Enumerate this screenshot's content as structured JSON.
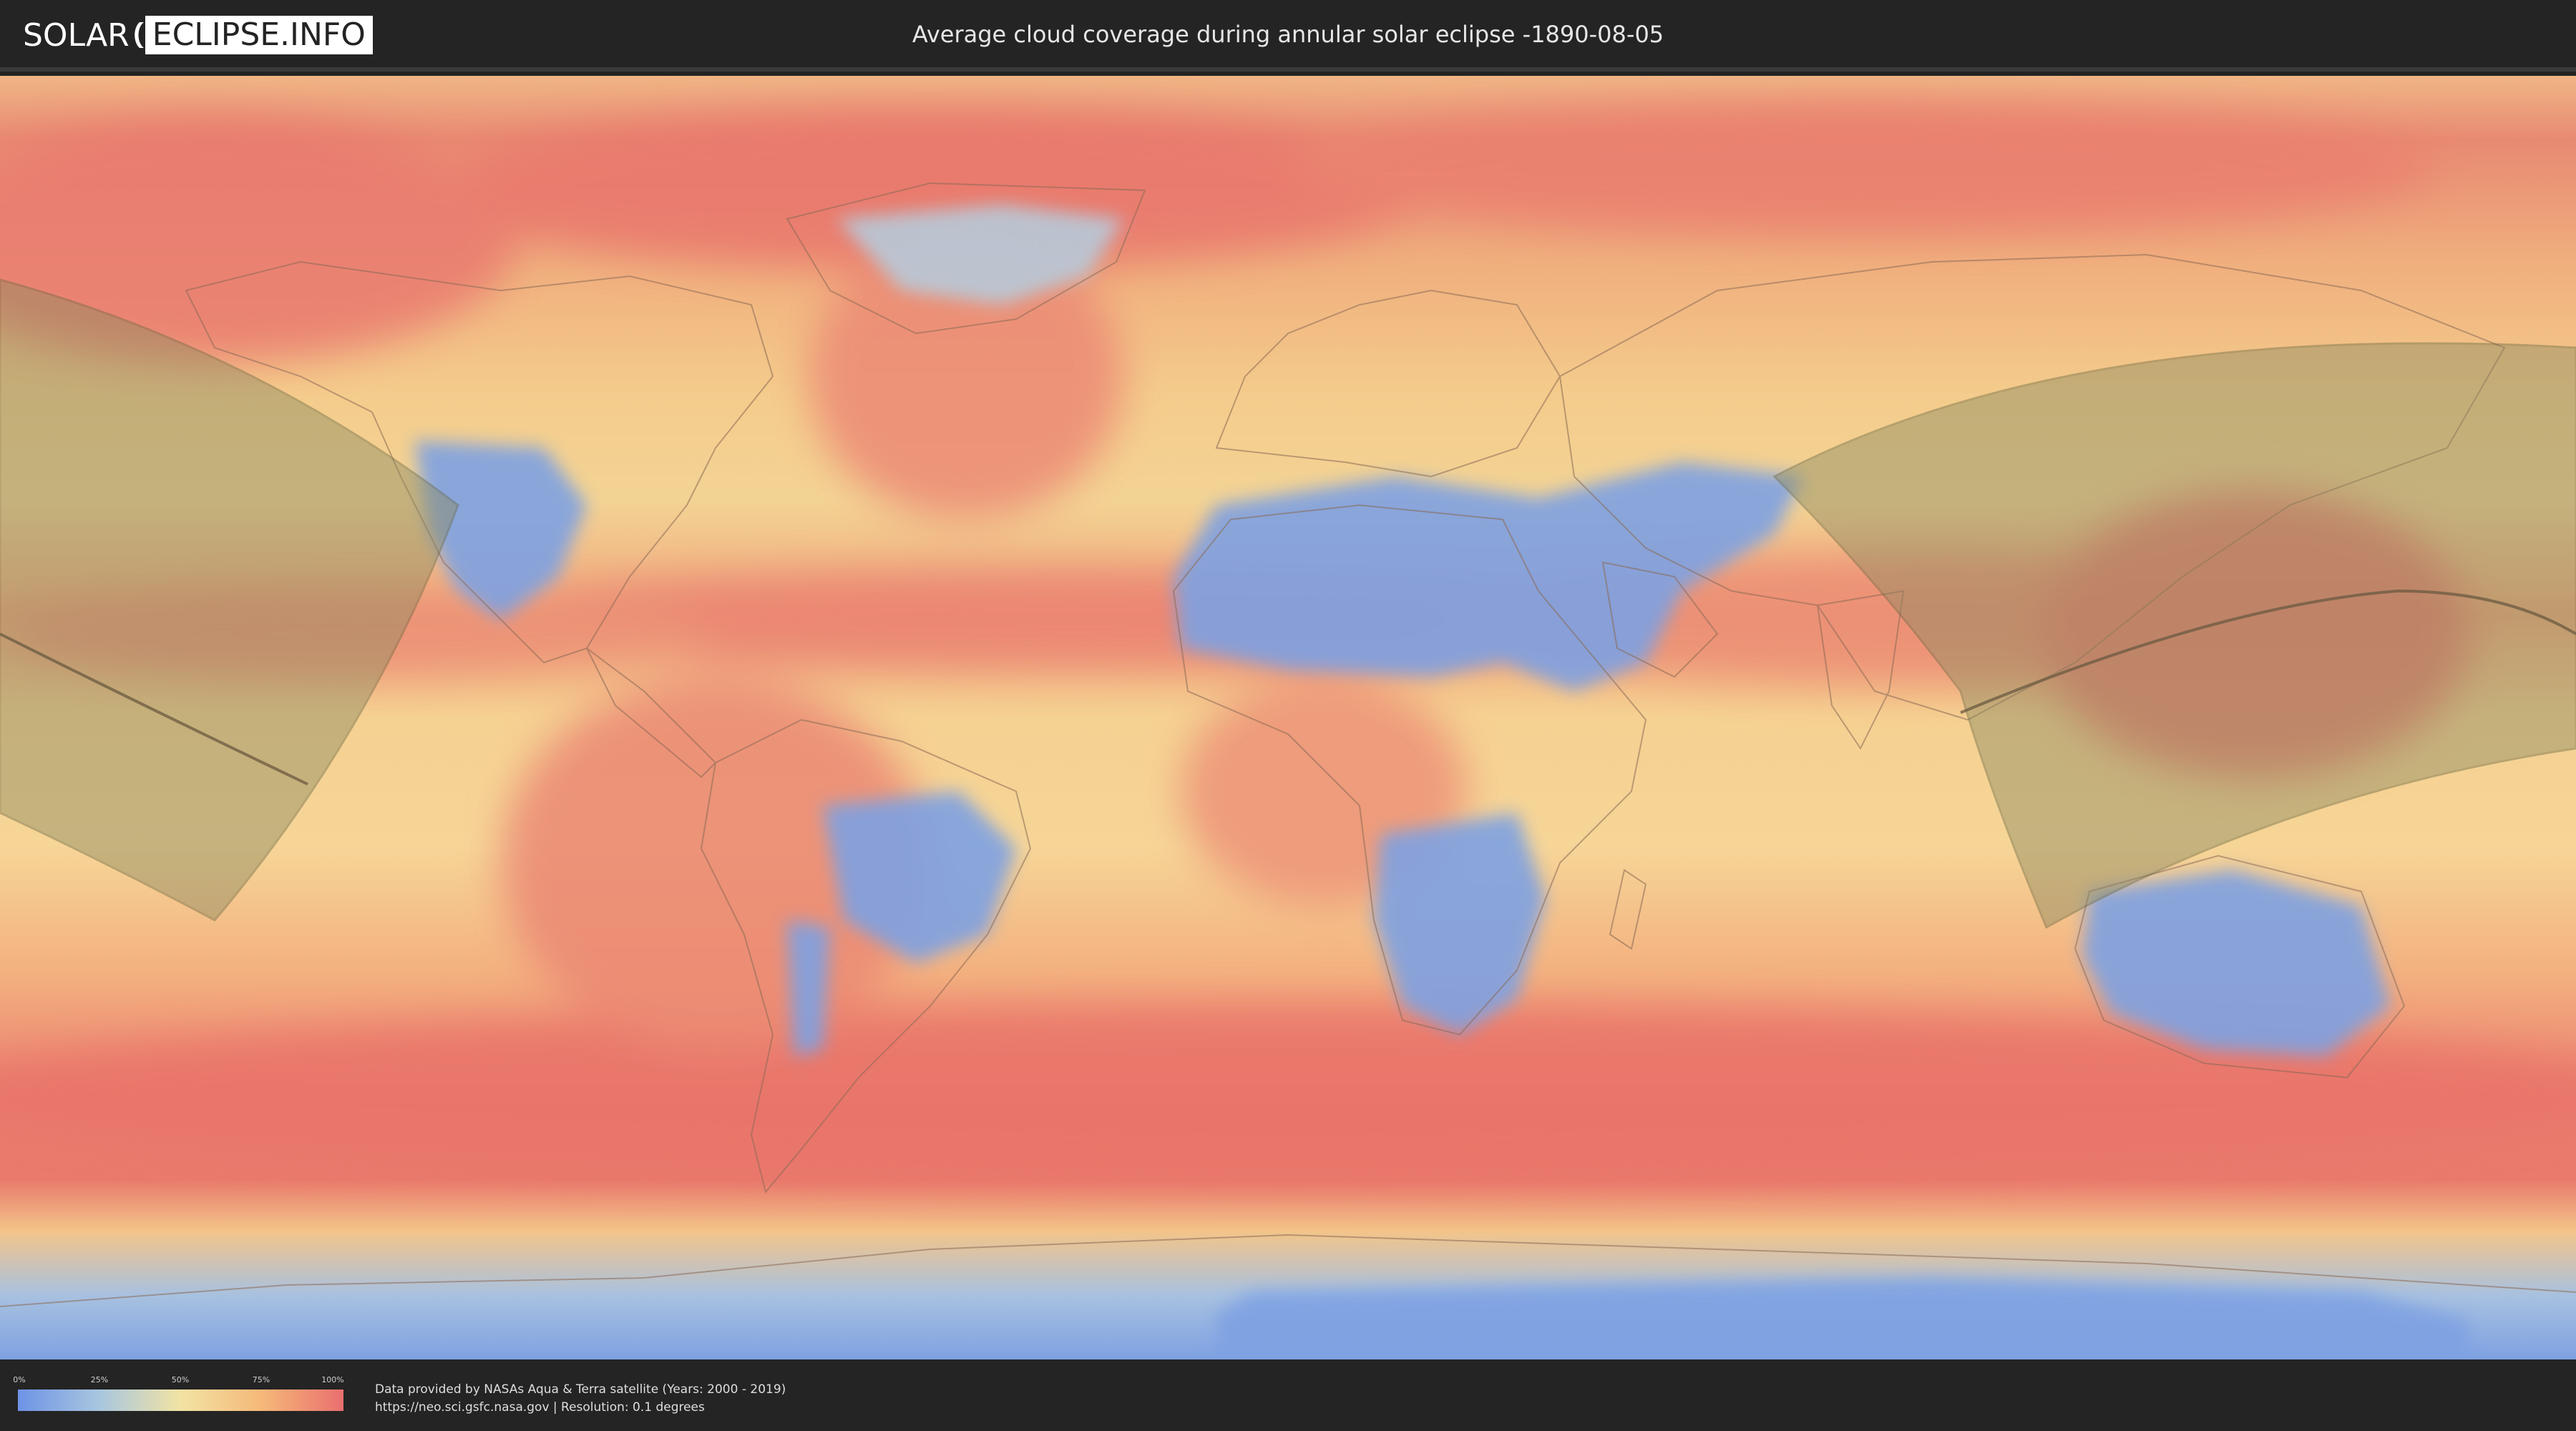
{
  "header": {
    "logo_part1": "SOLAR",
    "logo_part2": "ECLIPSE.INFO",
    "title": "Average cloud coverage during annular solar eclipse -1890-08-05"
  },
  "legend": {
    "ticks": [
      "0%",
      "25%",
      "50%",
      "75%",
      "100%"
    ],
    "colors": [
      "#6e93e6",
      "#a8c6df",
      "#f2e3a4",
      "#f5b878",
      "#ea6f6f"
    ]
  },
  "credits": {
    "line1": "Data provided by NASAs Aqua & Terra satellite (Years: 2000 - 2019)",
    "line2": "https://neo.sci.gsfc.nasa.gov | Resolution: 0.1 degrees"
  },
  "map": {
    "projection": "equirectangular",
    "layer": "cloud-coverage-heatmap",
    "overlay": "eclipse-visibility-zone-and-central-path",
    "colors": {
      "cloudy": "#ea6f6f",
      "medium": "#f5c884",
      "clear": "#7ea1e2",
      "eclipse_zone": "#8c8a60"
    }
  }
}
